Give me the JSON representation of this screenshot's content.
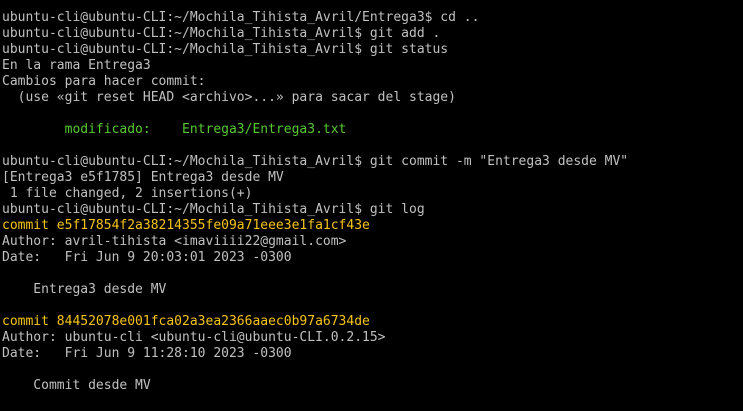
{
  "terminal": {
    "colors": {
      "background": "#000000",
      "text": "#c0c0c0",
      "commit_hash": "#f5c518",
      "modified_file": "#55c92f"
    },
    "lines": [
      {
        "text": "ubuntu-cli@ubuntu-CLI:~/Mochila_Tihista_Avril/Entrega3$ cd ..",
        "style": "normal"
      },
      {
        "text": "ubuntu-cli@ubuntu-CLI:~/Mochila_Tihista_Avril$ git add .",
        "style": "normal"
      },
      {
        "text": "ubuntu-cli@ubuntu-CLI:~/Mochila_Tihista_Avril$ git status",
        "style": "normal"
      },
      {
        "text": "En la rama Entrega3",
        "style": "normal"
      },
      {
        "text": "Cambios para hacer commit:",
        "style": "normal"
      },
      {
        "text": "  (use «git reset HEAD <archivo>...» para sacar del stage)",
        "style": "normal"
      },
      {
        "text": "",
        "style": "blank"
      },
      {
        "text": "        modificado:    Entrega3/Entrega3.txt",
        "style": "green"
      },
      {
        "text": "",
        "style": "blank"
      },
      {
        "text": "ubuntu-cli@ubuntu-CLI:~/Mochila_Tihista_Avril$ git commit -m \"Entrega3 desde MV\"",
        "style": "normal"
      },
      {
        "text": "[Entrega3 e5f1785] Entrega3 desde MV",
        "style": "normal"
      },
      {
        "text": " 1 file changed, 2 insertions(+)",
        "style": "normal"
      },
      {
        "text": "ubuntu-cli@ubuntu-CLI:~/Mochila_Tihista_Avril$ git log",
        "style": "normal"
      },
      {
        "text": "commit e5f17854f2a38214355fe09a71eee3e1fa1cf43e",
        "style": "yellow"
      },
      {
        "text": "Author: avril-tihista <imaviiii22@gmail.com>",
        "style": "normal"
      },
      {
        "text": "Date:   Fri Jun 9 20:03:01 2023 -0300",
        "style": "normal"
      },
      {
        "text": "",
        "style": "blank"
      },
      {
        "text": "    Entrega3 desde MV",
        "style": "normal"
      },
      {
        "text": "",
        "style": "blank"
      },
      {
        "text": "commit 84452078e001fca02a3ea2366aaec0b97a6734de",
        "style": "yellow"
      },
      {
        "text": "Author: ubuntu-cli <ubuntu-cli@ubuntu-CLI.0.2.15>",
        "style": "normal"
      },
      {
        "text": "Date:   Fri Jun 9 11:28:10 2023 -0300",
        "style": "normal"
      },
      {
        "text": "",
        "style": "blank"
      },
      {
        "text": "    Commit desde MV",
        "style": "normal"
      }
    ]
  }
}
